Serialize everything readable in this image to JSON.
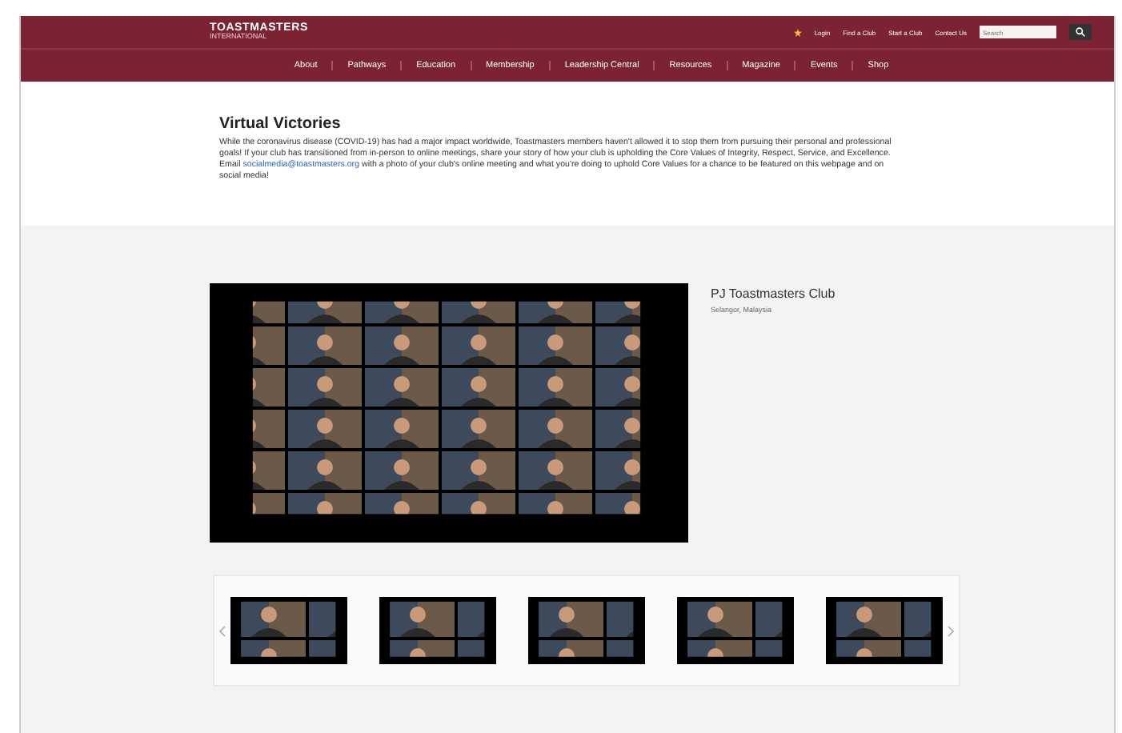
{
  "header": {
    "logo": "TOASTMASTERS",
    "tagline": "INTERNATIONAL",
    "top_links": [
      "Login",
      "Find a Club",
      "Start a Club",
      "Contact Us"
    ],
    "search": {
      "placeholder": "Search"
    },
    "nav": [
      "About",
      "Pathways",
      "Education",
      "Membership",
      "Leadership Central",
      "Resources",
      "Magazine",
      "Events",
      "Shop"
    ]
  },
  "article": {
    "title": "Virtual Victories",
    "body_before": "While the coronavirus disease (COVID-19) has had a major impact worldwide, Toastmasters members haven't allowed it to stop them from pursuing their personal and professional goals! If your club has transitioned from in-person to online meetings, share your story of how your club is upholding the Core Values of Integrity, Respect, Service, and Excellence. Email ",
    "link": "socialmedia@toastmasters.org",
    "body_after": " with a photo of your club's online meeting and what you're doing to uphold Core Values for a chance to be featured on this webpage and on social media!"
  },
  "featured": {
    "club": "PJ Toastmasters Club",
    "location": "Selangor, Malaysia"
  }
}
